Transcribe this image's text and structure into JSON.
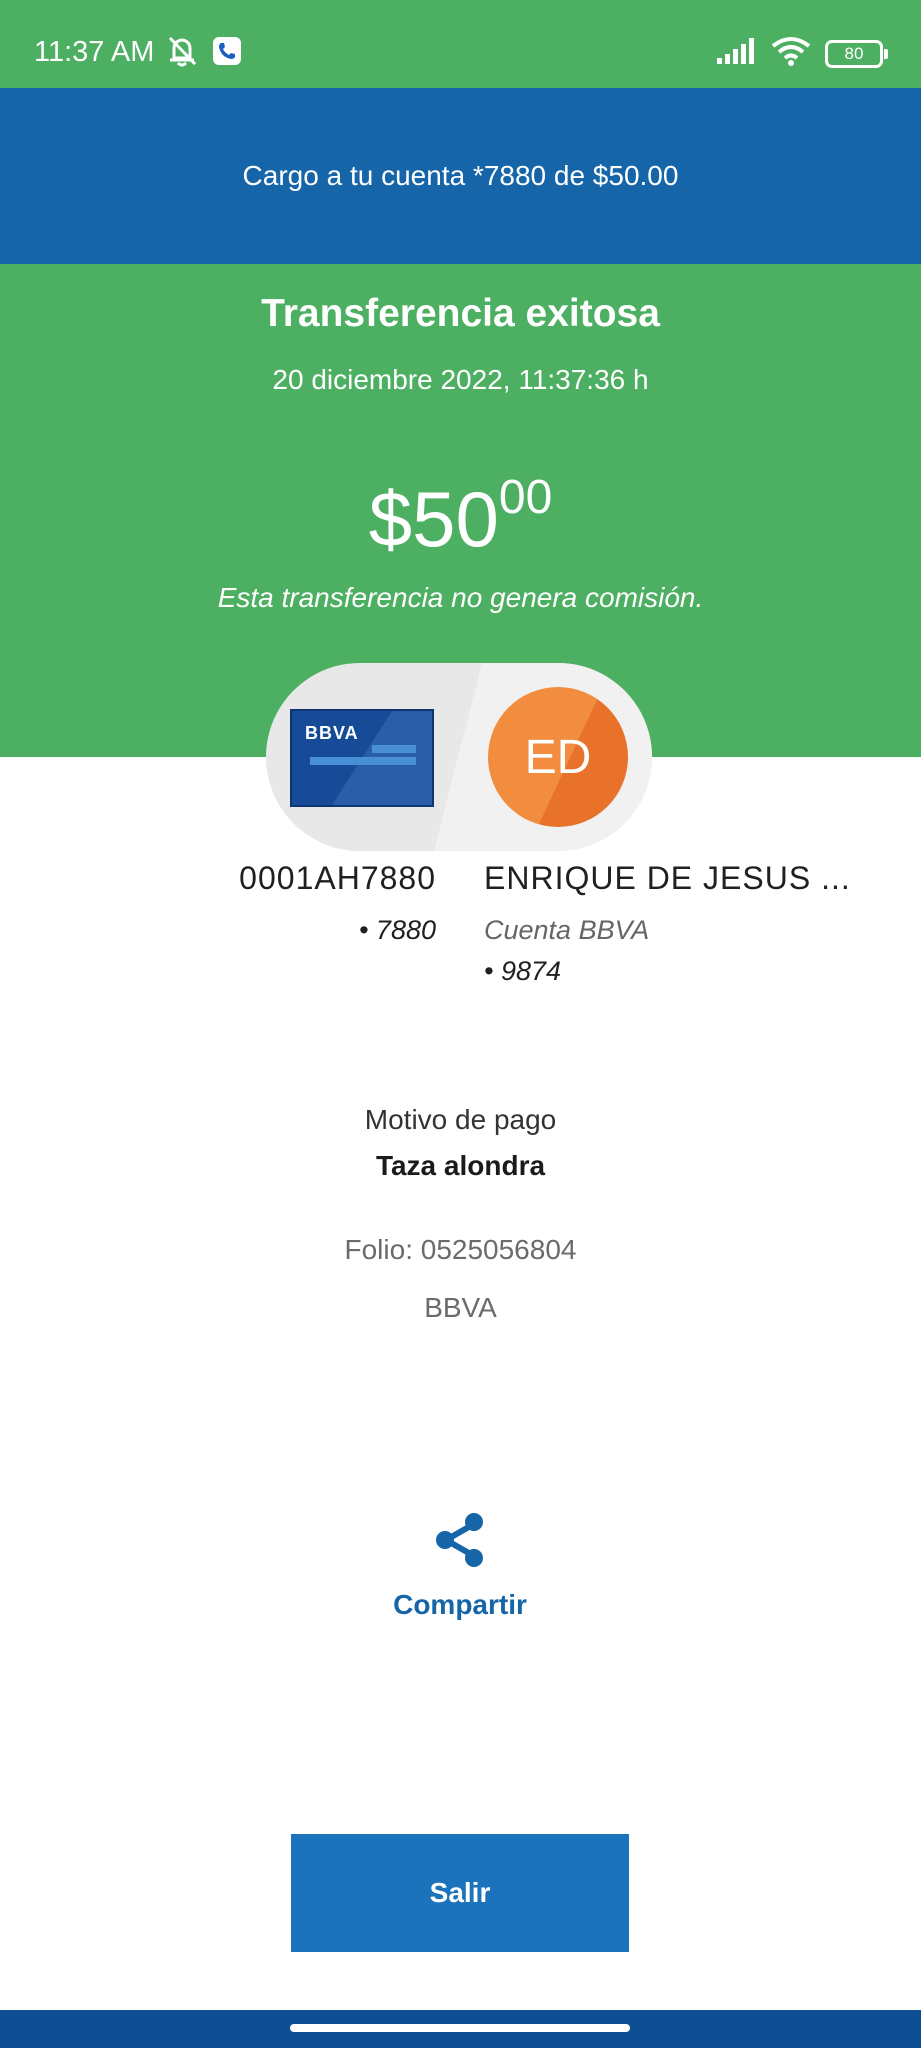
{
  "status_bar": {
    "time": "11:37 AM",
    "battery": "80"
  },
  "banner": {
    "text": "Cargo a tu cuenta *7880 de $50.00"
  },
  "transfer": {
    "title": "Transferencia exitosa",
    "date": "20 diciembre 2022, 11:37:36 h",
    "amount_main": "$50",
    "amount_cents": "00",
    "commission_note": "Esta transferencia no genera comisión."
  },
  "origin_account": {
    "card_logo": "BBVA",
    "name": "0001AH7880",
    "number": "• 7880"
  },
  "destination_account": {
    "initials": "ED",
    "name": "ENRIQUE DE JESUS ...",
    "type": "Cuenta BBVA",
    "number": "• 9874"
  },
  "details": {
    "reason_label": "Motivo de pago",
    "reason_value": "Taza alondra",
    "folio": "Folio: 0525056804",
    "bank": "BBVA"
  },
  "actions": {
    "share_label": "Compartir",
    "exit_label": "Salir"
  },
  "colors": {
    "green": "#4caf61",
    "blue_banner": "#1565a8",
    "accent_blue": "#1b73bb",
    "avatar_orange": "#f28c3e"
  }
}
